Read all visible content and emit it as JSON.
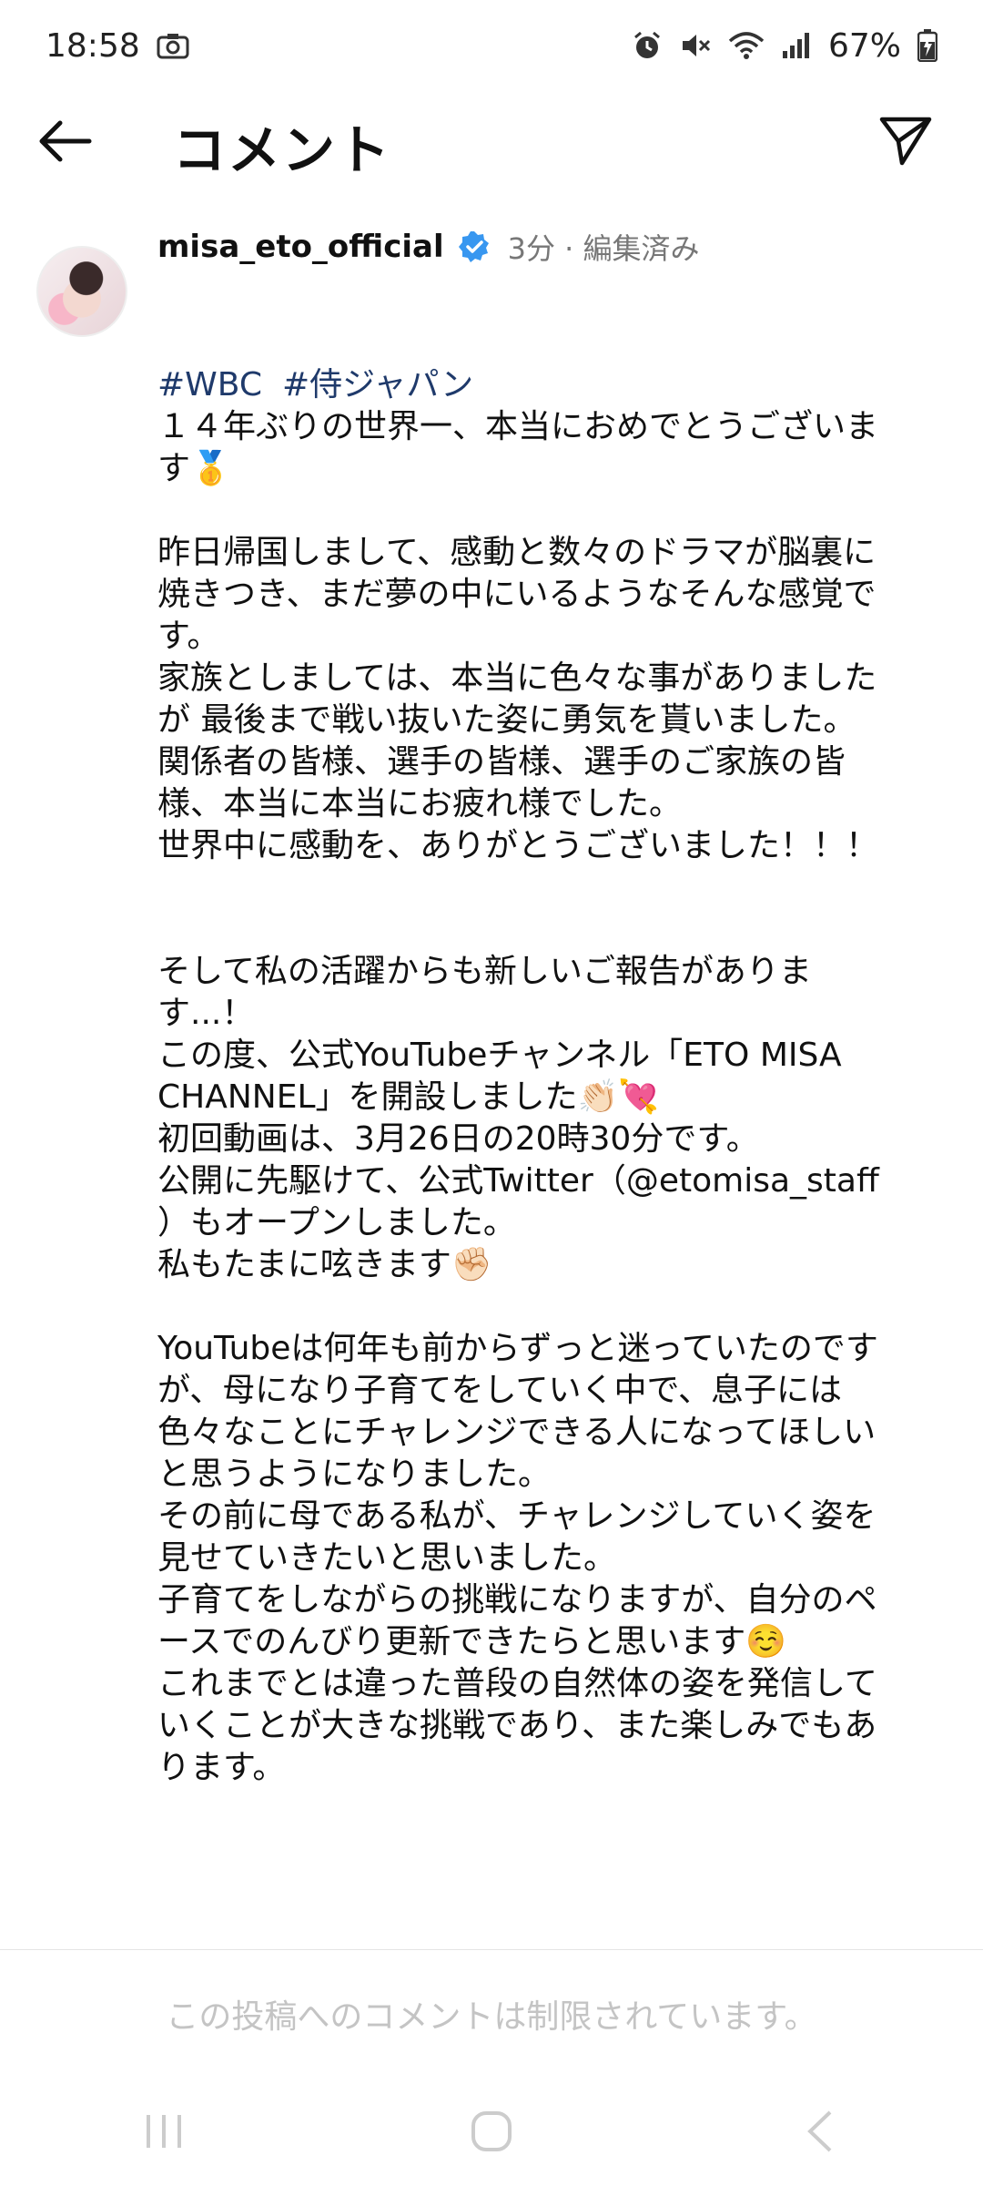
{
  "status": {
    "time": "18:58",
    "battery": "67%"
  },
  "topbar": {
    "title": "コメント"
  },
  "comment": {
    "username": "misa_eto_official",
    "meta": "3分 · 編集済み",
    "hashtags": [
      "#WBC",
      "#侍ジャパン"
    ],
    "paragraphs": [
      "１４年ぶりの世界一、本当におめでとうございます🥇",
      "昨日帰国しまして、感動と数々のドラマが脳裏に焼きつき、まだ夢の中にいるようなそんな感覚です。\n家族としましては、本当に色々な事がありましたが 最後まで戦い抜いた姿に勇気を貰いました。\n関係者の皆様、選手の皆様、選手のご家族の皆様、本当に本当にお疲れ様でした。\n世界中に感動を、ありがとうございました！！！",
      "そして私の活躍からも新しいご報告があります...！\nこの度、公式YouTubeチャンネル「ETO MISA CHANNEL」を開設しました👏🏻💘\n初回動画は、3月26日の20時30分です。\n公開に先駆けて、公式Twitter（@etomisa_staff ）もオープンしました。\n私もたまに呟きます✊🏻",
      "YouTubeは何年も前からずっと迷っていたのですが、母になり子育てをしていく中で、息子には色々なことにチャレンジできる人になってほしいと思うようになりました。\nその前に母である私が、チャレンジしていく姿を見せていきたいと思いました。\n子育てをしながらの挑戦になりますが、自分のペースでのんびり更新できたらと思います☺️\nこれまでとは違った普段の自然体の姿を発信していくことが大きな挑戦であり、また楽しみでもあります。"
    ]
  },
  "footer": {
    "restricted_text": "この投稿へのコメントは制限されています。"
  },
  "icons": {
    "back": "arrow-left-icon",
    "send": "send-icon",
    "verified": "verified-badge-icon"
  },
  "colors": {
    "hashtag": "#1f3a6b",
    "verified": "#3897f0",
    "meta": "#777777",
    "restricted": "#c4c4c4"
  }
}
